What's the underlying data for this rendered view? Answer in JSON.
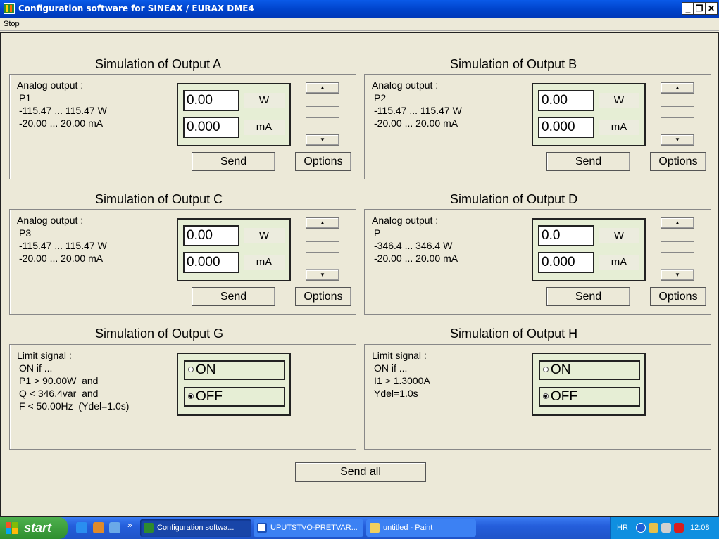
{
  "window": {
    "title": "Configuration software for SINEAX / EURAX DME4",
    "min_glyph": "_",
    "restore_glyph": "❐",
    "close_glyph": "✕"
  },
  "menu": {
    "stop": "Stop"
  },
  "outputs": [
    {
      "title": "Simulation of Output A",
      "desc_head": "Analog output :",
      "desc_lines": [
        "P1",
        "-115.47 ... 115.47 W",
        "-20.00 ... 20.00 mA"
      ],
      "value": "0.00",
      "value_unit": "W",
      "current": "0.000",
      "current_unit": "mA",
      "send": "Send",
      "options": "Options"
    },
    {
      "title": "Simulation of Output B",
      "desc_head": "Analog output :",
      "desc_lines": [
        "P2",
        "-115.47 ... 115.47 W",
        "-20.00 ... 20.00 mA"
      ],
      "value": "0.00",
      "value_unit": "W",
      "current": "0.000",
      "current_unit": "mA",
      "send": "Send",
      "options": "Options"
    },
    {
      "title": "Simulation of Output C",
      "desc_head": "Analog output :",
      "desc_lines": [
        "P3",
        "-115.47 ... 115.47 W",
        "-20.00 ... 20.00 mA"
      ],
      "value": "0.00",
      "value_unit": "W",
      "current": "0.000",
      "current_unit": "mA",
      "send": "Send",
      "options": "Options"
    },
    {
      "title": "Simulation of Output D",
      "desc_head": "Analog output :",
      "desc_lines": [
        "P",
        "-346.4 ... 346.4 W",
        "-20.00 ... 20.00 mA"
      ],
      "value": "0.0",
      "value_unit": "W",
      "current": "0.000",
      "current_unit": "mA",
      "send": "Send",
      "options": "Options"
    }
  ],
  "limits": [
    {
      "title": "Simulation of Output G",
      "desc_head": "Limit signal :",
      "desc_lines": [
        "ON if ...",
        "P1 > 90.00W  and",
        "Q < 346.4var  and",
        "F < 50.00Hz  (Ydel=1.0s)"
      ],
      "on_label": "ON",
      "off_label": "OFF",
      "selected": "OFF"
    },
    {
      "title": "Simulation of Output H",
      "desc_head": "Limit signal :",
      "desc_lines": [
        "ON if ...",
        "I1 > 1.3000A",
        "Ydel=1.0s"
      ],
      "on_label": "ON",
      "off_label": "OFF",
      "selected": "OFF"
    }
  ],
  "send_all": "Send all",
  "taskbar": {
    "start": "start",
    "tasks": [
      "Configuration softwa...",
      "UPUTSTVO-PRETVAR...",
      "untitled - Paint"
    ],
    "lang": "HR",
    "clock": "12:08",
    "overflow_glyph": "»"
  },
  "colors": {
    "title_bar": "#0044cc",
    "panel_bg": "#e6eed5",
    "taskbar": "#245edb",
    "start_button": "#2f8f2f"
  }
}
